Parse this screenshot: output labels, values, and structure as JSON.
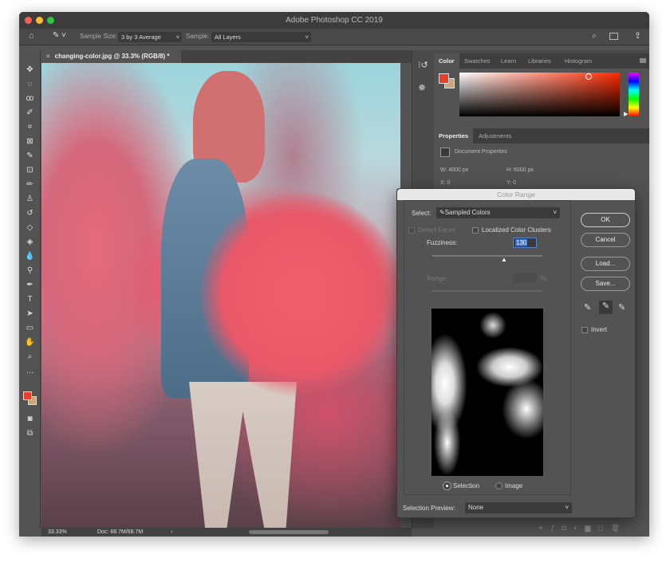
{
  "window": {
    "title": "Adobe Photoshop CC 2019"
  },
  "options_bar": {
    "sample_size_label": "Sample Size:",
    "sample_size_value": "3 by 3 Average",
    "sample_label": "Sample:",
    "sample_value": "All Layers"
  },
  "document": {
    "tab_title": "changing-color.jpg @ 33.3% (RGB/8) *"
  },
  "status": {
    "zoom": "33.33%",
    "doc": "Doc: 68.7M/68.7M"
  },
  "color_panel": {
    "tabs": [
      "Color",
      "Swatches",
      "Learn",
      "Libraries",
      "Histogram"
    ],
    "active": "Color",
    "foreground": "#e8402c",
    "background": "#c8a878"
  },
  "properties_panel": {
    "tabs": [
      "Properties",
      "Adjustments"
    ],
    "header": "Document Properties",
    "w": "W: 4000 px",
    "h": "H: 6000 px",
    "x": "X: 0",
    "y": "Y: 0"
  },
  "dialog": {
    "title": "Color Range",
    "select_label": "Select:",
    "select_value": "Sampled Colors",
    "detect_faces": "Detect Faces",
    "localized": "Localized Color Clusters",
    "localized_checked": false,
    "fuzziness_label": "Fuzziness:",
    "fuzziness_value": "130",
    "fuzziness_max": 200,
    "range_label": "Range:",
    "range_unit": "%",
    "preview_options": [
      "Selection",
      "Image"
    ],
    "preview_selected": "Selection",
    "selection_preview_label": "Selection Preview:",
    "selection_preview_value": "None",
    "buttons": {
      "ok": "OK",
      "cancel": "Cancel",
      "load": "Load...",
      "save": "Save..."
    },
    "invert": "Invert",
    "invert_checked": false
  }
}
